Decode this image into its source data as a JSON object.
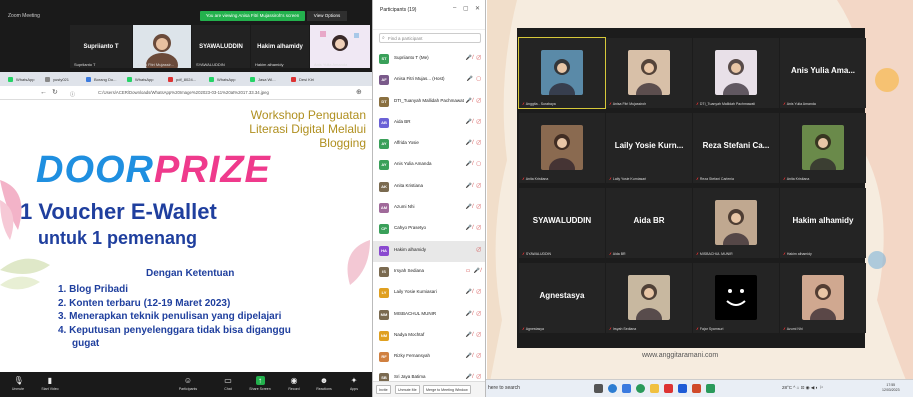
{
  "zoom": {
    "window_title": "Zoom Meeting",
    "share_banner": "You are viewing Anisa Fitri Mujassiroh's screen",
    "view_options": "View Options",
    "top_tiles": [
      {
        "name": "Supriianto T",
        "sub": "Supriianto T"
      },
      {
        "name": "",
        "sub": "Anisa Fitri Mujassir..."
      },
      {
        "name": "SYAWALUDDIN",
        "sub": "SYAWALUDDIN"
      },
      {
        "name": "Hakim alhamidy",
        "sub": "Hakim alhamidy"
      },
      {
        "name": "",
        "sub": "Anis Yulia Amanda"
      }
    ],
    "browser_tabs": [
      "WhatsApp",
      "yusty021",
      "Borang Do...",
      "WhatsApp",
      "pdf_8024...",
      "WhatsApp",
      "Jasa Wi...",
      "Desi Kiri"
    ],
    "address": "C:/Users/ACER/Downloads/WhatsApp%20Image%202023-03-11%20at%2017.33.34.jpeg",
    "toolbar": [
      {
        "label": "Unmute",
        "icon": "mic"
      },
      {
        "label": "Start Video",
        "icon": "video"
      },
      {
        "label": "Participants",
        "icon": "people"
      },
      {
        "label": "Chat",
        "icon": "chat"
      },
      {
        "label": "Share Screen",
        "icon": "share"
      },
      {
        "label": "Record",
        "icon": "record"
      },
      {
        "label": "Reactions",
        "icon": "emoji"
      },
      {
        "label": "Apps",
        "icon": "apps"
      }
    ]
  },
  "slide": {
    "workshop_line1": "Workshop Penguatan",
    "workshop_line2": "Literasi Digital Melalui",
    "workshop_line3": "Blogging",
    "door": "DOOR",
    "prize": "PRIZE",
    "voucher": "1 Voucher E-Wallet",
    "winner": "untuk 1 pemenang",
    "terms_title": "Dengan Ketentuan",
    "terms": [
      "1. Blog Pribadi",
      "2. Konten terbaru (12-19 Maret 2023)",
      "3. Menerapkan teknik penulisan yang dipelajari",
      "4. Keputusan penyelenggara tidak bisa diganggu",
      "    gugat"
    ],
    "colors": {
      "door": "#1f8fe0",
      "prize": "#ef3a8c",
      "blue": "#1f3f9e",
      "gold": "#b09020"
    }
  },
  "participants": {
    "title": "Participants (19)",
    "search_placeholder": "Find a participant",
    "list": [
      {
        "initials": "ST",
        "name": "Supriianto T (Me)",
        "color": "#3aa05a",
        "icons": "🎤̸ ▢̸"
      },
      {
        "initials": "AF",
        "name": "Anisa Fitri Mujas... (Host)",
        "color": "#7a5a8a",
        "icons": "🎤 ▢"
      },
      {
        "initials": "DT",
        "name": "DTI_Tuanyah Mallidah Pachmawati",
        "color": "#8a7040",
        "icons": "🎤̸ ▢̸"
      },
      {
        "initials": "AB",
        "name": "Aida BR",
        "color": "#6b62d6",
        "icons": "🎤̸ ▢̸"
      },
      {
        "initials": "AY",
        "name": "Affrida Yosie",
        "color": "#3aa05a",
        "icons": "🎤̸ ▢̸"
      },
      {
        "initials": "AY",
        "name": "Anis Yulia Amanda",
        "color": "#3aa05a",
        "icons": "🎤̸ ▢"
      },
      {
        "initials": "AK",
        "name": "Anita Kristiana",
        "color": "#7a6a50",
        "icons": "🎤̸ ▢̸"
      },
      {
        "initials": "AM",
        "name": "Azumi Nhi",
        "color": "#a06a9a",
        "icons": "🎤̸ ▢̸"
      },
      {
        "initials": "CP",
        "name": "Cahyo Prasetyo",
        "color": "#3aa05a",
        "icons": "🎤̸ ▢̸"
      },
      {
        "initials": "HA",
        "name": "Hakim alhamidy",
        "color": "#8a4ad0",
        "icons": "▢̸",
        "selected": true
      },
      {
        "initials": "IS",
        "name": "Irsyah Sediana",
        "color": "#7a6a50",
        "icons": "▭ 🎤̸"
      },
      {
        "initials": "LY",
        "name": "Laily Yosie Kurniasari",
        "color": "#e0a020",
        "icons": "🎤̸ ▢̸"
      },
      {
        "initials": "MM",
        "name": "MISBACHUL MUNIR",
        "color": "#7a6a50",
        "icons": "🎤̸ ▢̸"
      },
      {
        "initials": "NM",
        "name": "Nadya Mochtaf",
        "color": "#e0a020",
        "icons": "🎤̸ ▢̸"
      },
      {
        "initials": "RF",
        "name": "Rizky Fernansyah",
        "color": "#d08040",
        "icons": "🎤̸ ▢̸"
      },
      {
        "initials": "SB",
        "name": "Sri Jaya Batima",
        "color": "#7a6a50",
        "icons": "🎤̸ ▢̸"
      }
    ],
    "footer": [
      "Invite",
      "Unmute Me",
      "Merge to Meeting Window"
    ]
  },
  "gallery": {
    "tiles": [
      {
        "name": "",
        "sub": "Anggita - Surabaya",
        "pic": "#5a8aa8",
        "active": true
      },
      {
        "name": "",
        "sub": "Anisa Fitri Mujassiroh",
        "pic": "#d8c0a8"
      },
      {
        "name": "",
        "sub": "DTI_Tuanyah Mallidah Pachmawati",
        "pic": "#e8e0e8"
      },
      {
        "name": "Anis Yulia Ama...",
        "sub": "Anis Yulia Amanda"
      },
      {
        "name": "",
        "sub": "Anita Kristiana",
        "pic": "#8a6a50"
      },
      {
        "name": "Laily Yosie Kurn...",
        "sub": "Laily Yosie Kurniasari"
      },
      {
        "name": "Reza Stefani Ca...",
        "sub": "Reza Stefani Carlenia"
      },
      {
        "name": "",
        "sub": "Anita Kristiana",
        "pic": "#6a8a4a"
      },
      {
        "name": "SYAWALUDDIN",
        "sub": "SYAWALUDDIN"
      },
      {
        "name": "Aida BR",
        "sub": "Aida BR"
      },
      {
        "name": "",
        "sub": "MISBACHUL MUNIR",
        "pic": "#c0a890"
      },
      {
        "name": "Hakim alhamidy",
        "sub": "Hakim alhamidy"
      },
      {
        "name": "Agnestasya",
        "sub": "Agnestasya"
      },
      {
        "name": "",
        "sub": "Irsyah Sediana",
        "pic": "#c8b8a0"
      },
      {
        "name": "",
        "sub": "Fajar Syamsuri",
        "pic": "#000000"
      },
      {
        "name": "",
        "sub": "Azumi Nhi",
        "pic": "#d0a890"
      }
    ],
    "watermark": "www.anggitaramani.com"
  },
  "taskbar": {
    "search": "here to search",
    "tray": "28°C  ^ ⌂ ⊡ ◉ ◀ ◐ ⚐",
    "time": "17:55",
    "date": "12/03/2023"
  }
}
